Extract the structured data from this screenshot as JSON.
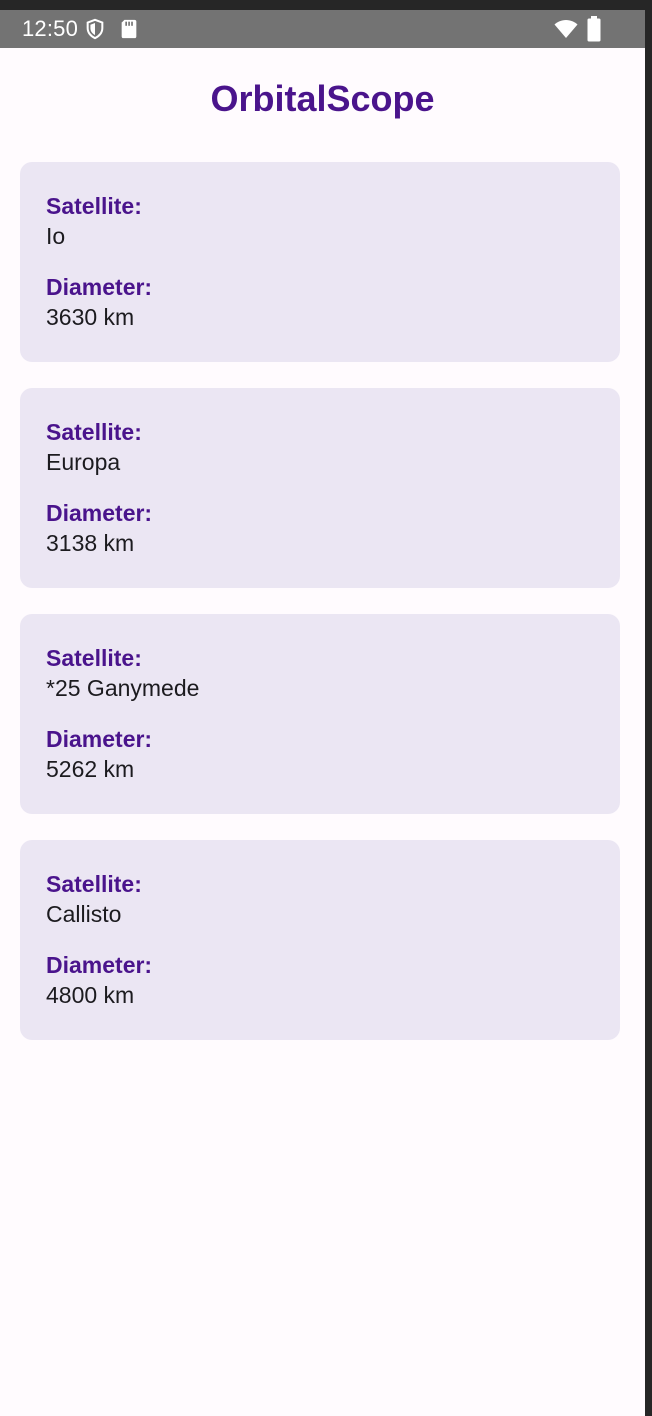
{
  "status_bar": {
    "time": "12:50",
    "icons": [
      "shield-icon",
      "sd-card-icon",
      "wifi-icon",
      "battery-icon"
    ]
  },
  "app": {
    "title": "OrbitalScope",
    "accent_color": "#4a148c"
  },
  "labels": {
    "satellite": "Satellite:",
    "diameter": "Diameter:"
  },
  "satellites": [
    {
      "name": "Io",
      "diameter": "3630 km"
    },
    {
      "name": "Europa",
      "diameter": "3138 km"
    },
    {
      "name": "*25 Ganymede",
      "diameter": "5262 km"
    },
    {
      "name": "Callisto",
      "diameter": "4800 km"
    }
  ]
}
